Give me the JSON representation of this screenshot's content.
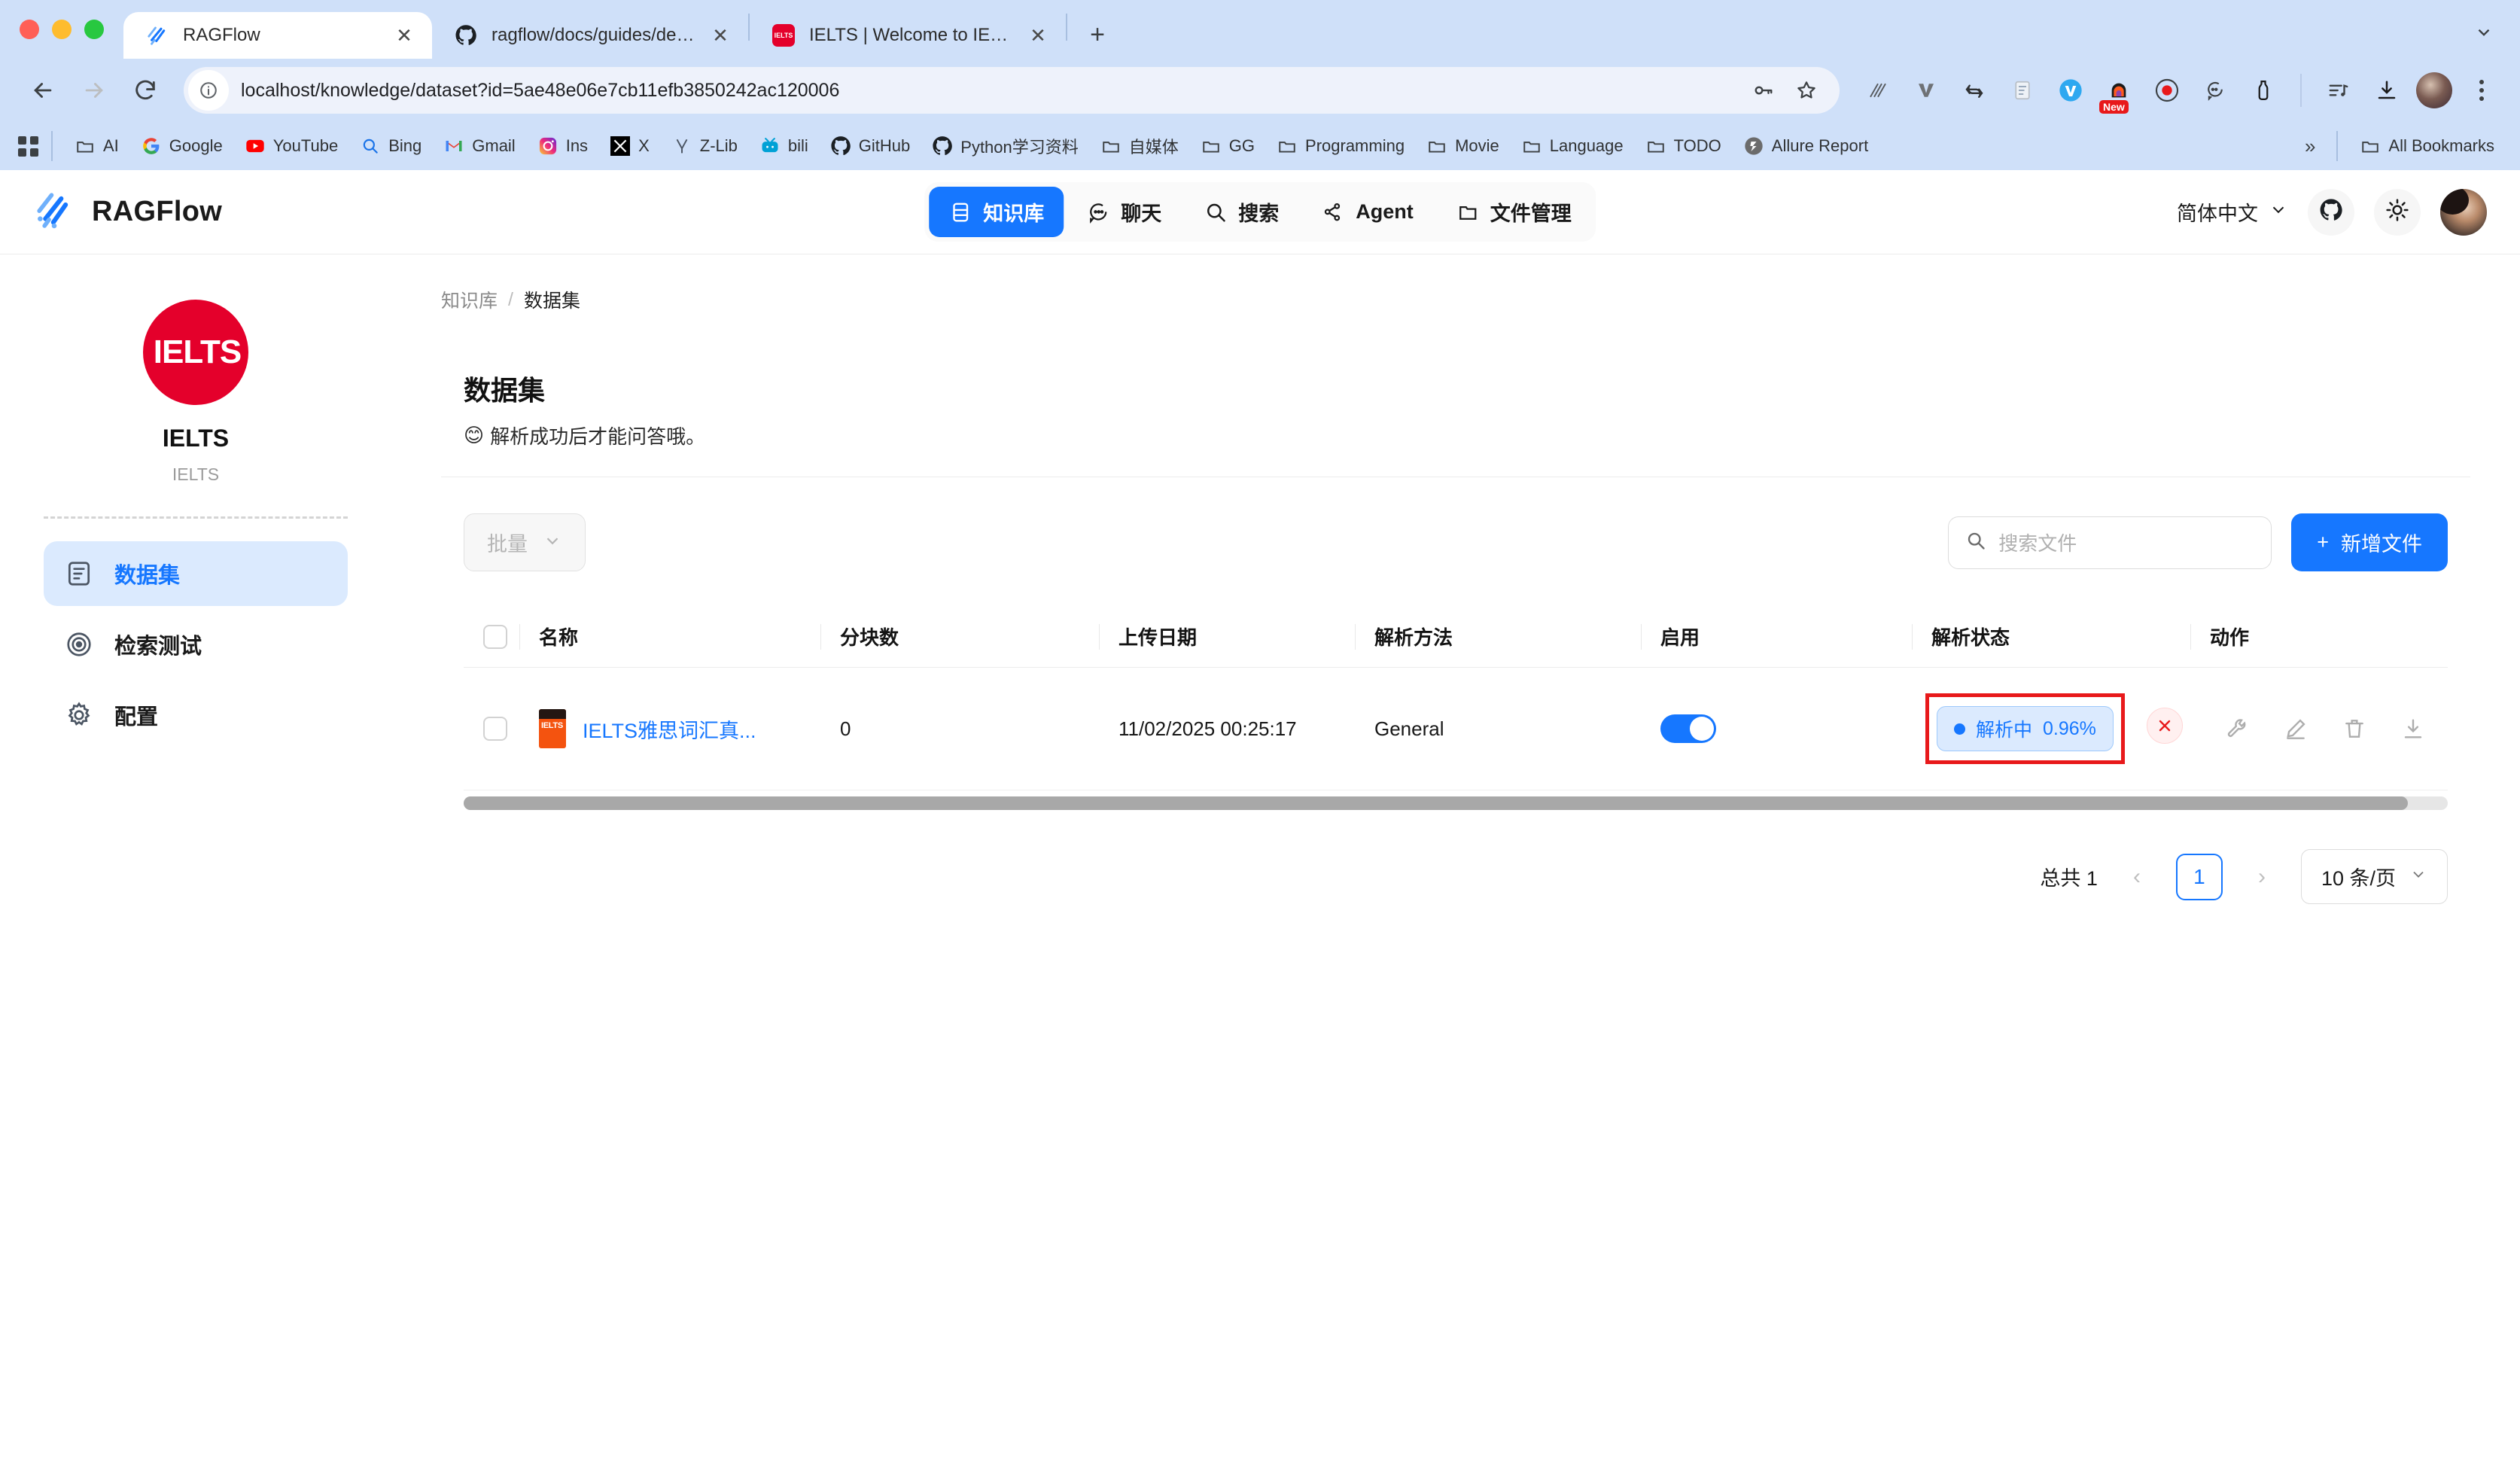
{
  "browser": {
    "tabs": [
      {
        "title": "RAGFlow",
        "favicon": "ragflow-icon",
        "active": true
      },
      {
        "title": "ragflow/docs/guides/deploy_",
        "favicon": "github-icon",
        "active": false
      },
      {
        "title": "IELTS | Welcome to IELTS",
        "favicon": "ielts-icon",
        "active": false
      }
    ],
    "new_tab_label": "+",
    "close_label": "✕",
    "url": "localhost/knowledge/dataset?id=5ae48e06e7cb11efb3850242ac120006",
    "extension_badge": "New",
    "bookmarks": [
      {
        "label": "AI",
        "icon": "folder-icon"
      },
      {
        "label": "Google",
        "icon": "google-icon"
      },
      {
        "label": "YouTube",
        "icon": "youtube-icon"
      },
      {
        "label": "Bing",
        "icon": "bing-icon"
      },
      {
        "label": "Gmail",
        "icon": "gmail-icon"
      },
      {
        "label": "Ins",
        "icon": "instagram-icon"
      },
      {
        "label": "X",
        "icon": "x-icon"
      },
      {
        "label": "Z-Lib",
        "icon": "zlib-icon"
      },
      {
        "label": "bili",
        "icon": "bilibili-icon"
      },
      {
        "label": "GitHub",
        "icon": "github-icon"
      },
      {
        "label": "Python学习资料",
        "icon": "github-icon"
      },
      {
        "label": "自媒体",
        "icon": "folder-icon"
      },
      {
        "label": "GG",
        "icon": "folder-icon"
      },
      {
        "label": "Programming",
        "icon": "folder-icon"
      },
      {
        "label": "Movie",
        "icon": "folder-icon"
      },
      {
        "label": "Language",
        "icon": "folder-icon"
      },
      {
        "label": "TODO",
        "icon": "folder-icon"
      },
      {
        "label": "Allure Report",
        "icon": "allure-icon"
      }
    ],
    "overflow_label": "»",
    "all_bookmarks": "All Bookmarks"
  },
  "header": {
    "brand": "RAGFlow",
    "nav": [
      {
        "label": "知识库",
        "icon": "database-icon",
        "active": true
      },
      {
        "label": "聊天",
        "icon": "chat-icon",
        "active": false
      },
      {
        "label": "搜索",
        "icon": "search-icon",
        "active": false
      },
      {
        "label": "Agent",
        "icon": "agent-icon",
        "active": false
      },
      {
        "label": "文件管理",
        "icon": "folder-icon",
        "active": false
      }
    ],
    "language": "简体中文",
    "language_chevron": "∨"
  },
  "sidebar": {
    "kb_logo_text": "IELTS",
    "kb_title": "IELTS",
    "kb_subtitle": "IELTS",
    "items": [
      {
        "label": "数据集",
        "icon": "dataset-icon",
        "active": true
      },
      {
        "label": "检索测试",
        "icon": "target-icon",
        "active": false
      },
      {
        "label": "配置",
        "icon": "gear-icon",
        "active": false
      }
    ]
  },
  "main": {
    "breadcrumb": {
      "root": "知识库",
      "separator": "/",
      "current": "数据集"
    },
    "page_title": "数据集",
    "page_subtitle": "解析成功后才能问答哦。",
    "page_subtitle_emoji": "😊",
    "toolbar": {
      "batch_label": "批量",
      "batch_chevron": "∨",
      "search_placeholder": "搜索文件",
      "add_label": "新增文件",
      "add_plus": "+"
    },
    "table": {
      "columns": [
        "名称",
        "分块数",
        "上传日期",
        "解析方法",
        "启用",
        "解析状态",
        "动作"
      ],
      "rows": [
        {
          "name": "IELTS雅思词汇真...",
          "thumb_text": "IELTS",
          "chunks": "0",
          "upload_date": "11/02/2025 00:25:17",
          "parse_method": "General",
          "enabled": true,
          "status_label": "解析中",
          "status_percent": "0.96%",
          "status_color": "#1677ff",
          "highlight_color": "#e8191b",
          "cancel_label": "✕",
          "actions": [
            "wrench-icon",
            "pencil-icon",
            "trash-icon",
            "download-icon"
          ]
        }
      ]
    },
    "pagination": {
      "total_label": "总共 1",
      "prev": "‹",
      "current_page": "1",
      "next": "›",
      "page_size": "10 条/页",
      "page_size_chevron": "∨"
    }
  }
}
